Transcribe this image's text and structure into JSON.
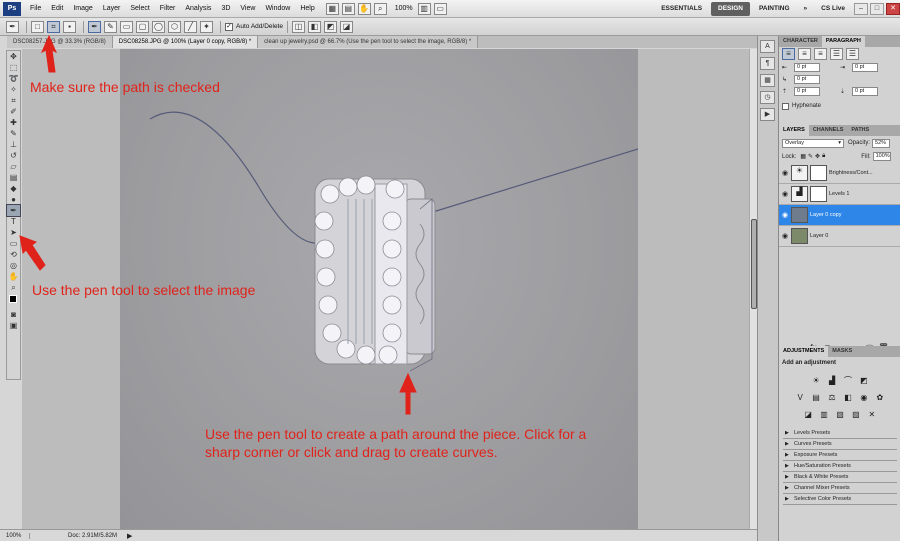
{
  "menubar": {
    "logo": "Ps",
    "items": [
      "File",
      "Edit",
      "Image",
      "Layer",
      "Select",
      "Filter",
      "Analysis",
      "3D",
      "View",
      "Window",
      "Help"
    ],
    "zoom": "100%",
    "workspaces": [
      "ESSENTIALS",
      "DESIGN",
      "PAINTING"
    ],
    "active_workspace": "DESIGN",
    "more": "»",
    "cslive": "CS Live",
    "window_buttons": [
      "–",
      "□",
      "✕"
    ]
  },
  "options": {
    "auto_add_delete": "Auto Add/Delete"
  },
  "tabs": [
    "DSC08257.JPG @ 33.3% (RGB/8)",
    "DSC08258.JPG @ 100% (Layer 0 copy, RGB/8) *",
    "clean up jewelry.psd @ 66.7% (Use the pen tool to select the image, RGB/8) *"
  ],
  "active_tab": 1,
  "annotations": {
    "path_checked": "Make sure the path is checked",
    "pen_tool": "Use the pen tool to select the image",
    "create_path_line1": "Use the pen tool to create a path around the piece. Click for a",
    "create_path_line2": "sharp corner or click and drag to create curves."
  },
  "status": {
    "zoom": "100%",
    "doc": "Doc: 2.91M/5.82M"
  },
  "character_panel": {
    "tabs": [
      "CHARACTER",
      "PARAGRAPH"
    ],
    "active": "PARAGRAPH",
    "values": [
      "0 pt",
      "0 pt",
      "0 pt",
      "0 pt",
      "0 pt"
    ],
    "hyphenate": "Hyphenate"
  },
  "layers_panel": {
    "tabs": [
      "LAYERS",
      "CHANNELS",
      "PATHS"
    ],
    "blend_mode": "Overlay",
    "opacity_label": "Opacity:",
    "opacity": "52%",
    "lock_label": "Lock:",
    "fill_label": "Fill:",
    "fill": "100%",
    "layers": [
      {
        "name": "Brightness/Cont...",
        "thumb": "#f2f2f2"
      },
      {
        "name": "Levels 1",
        "thumb": "#f2f2f2"
      },
      {
        "name": "Layer 0 copy",
        "thumb": "#6f7c8e"
      },
      {
        "name": "Layer 0",
        "thumb": "#7d8a6a"
      }
    ],
    "active_layer": 2
  },
  "adjustments_panel": {
    "tabs": [
      "ADJUSTMENTS",
      "MASKS"
    ],
    "heading": "Add an adjustment",
    "presets": [
      "Levels Presets",
      "Curves Presets",
      "Exposure Presets",
      "Hue/Saturation Presets",
      "Black & White Presets",
      "Channel Mixer Presets",
      "Selective Color Presets"
    ]
  },
  "colors": {
    "annotation_red": "#e0231a",
    "active_layer": "#2d86e8",
    "canvas_gray": "#bcbcbc"
  }
}
